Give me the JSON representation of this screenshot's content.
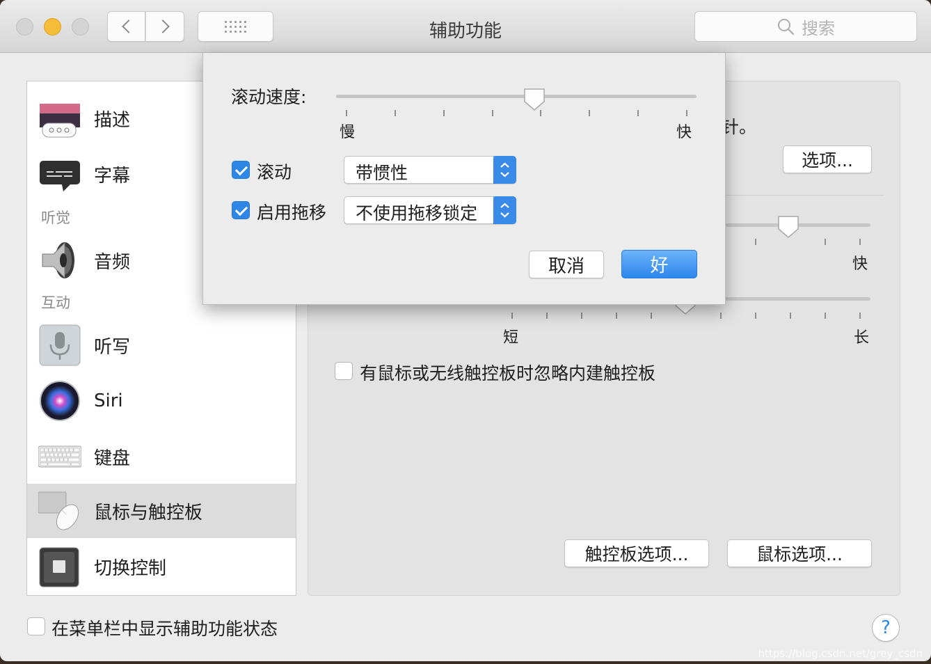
{
  "window": {
    "title": "辅助功能",
    "search_placeholder": "搜索"
  },
  "sidebar": {
    "items": [
      {
        "label": "描述",
        "icon": "descriptions-icon"
      },
      {
        "label": "字幕",
        "icon": "captions-icon"
      },
      {
        "label": "音频",
        "icon": "speaker-icon"
      },
      {
        "label": "听写",
        "icon": "microphone-icon"
      },
      {
        "label": "Siri",
        "icon": "siri-icon"
      },
      {
        "label": "键盘",
        "icon": "keyboard-icon"
      },
      {
        "label": "鼠标与触控板",
        "icon": "mouse-trackpad-icon",
        "selected": true
      },
      {
        "label": "切换控制",
        "icon": "switch-control-icon"
      }
    ],
    "sections": {
      "hearing": "听觉",
      "interaction": "互动"
    }
  },
  "content": {
    "pointer_text_fragment": "针。",
    "options_button": "选项...",
    "double_click_slider_fast": "快",
    "spring_slider_short": "短",
    "spring_slider_long": "长",
    "ignore_trackpad_label": "有鼠标或无线触控板时忽略内建触控板",
    "trackpad_options_button": "触控板选项...",
    "mouse_options_button": "鼠标选项..."
  },
  "sheet": {
    "scroll_speed_label": "滚动速度:",
    "scroll_speed_value": 0.55,
    "slow_label": "慢",
    "fast_label": "快",
    "scrolling": {
      "checked": true,
      "label": "滚动",
      "selected": "带惯性"
    },
    "dragging": {
      "checked": true,
      "label": "启用拖移",
      "selected": "不使用拖移锁定"
    },
    "cancel_button": "取消",
    "ok_button": "好"
  },
  "footer": {
    "menu_bar_status_label": "在菜单栏中显示辅助功能状态",
    "menu_bar_status_checked": false,
    "help": "?"
  },
  "watermark": "https://blog.csdn.net/grey_csdn",
  "colors": {
    "accent": "#2e86e6",
    "close_button": "#d4d4d4",
    "minimize_button": "#f6bd3b"
  }
}
